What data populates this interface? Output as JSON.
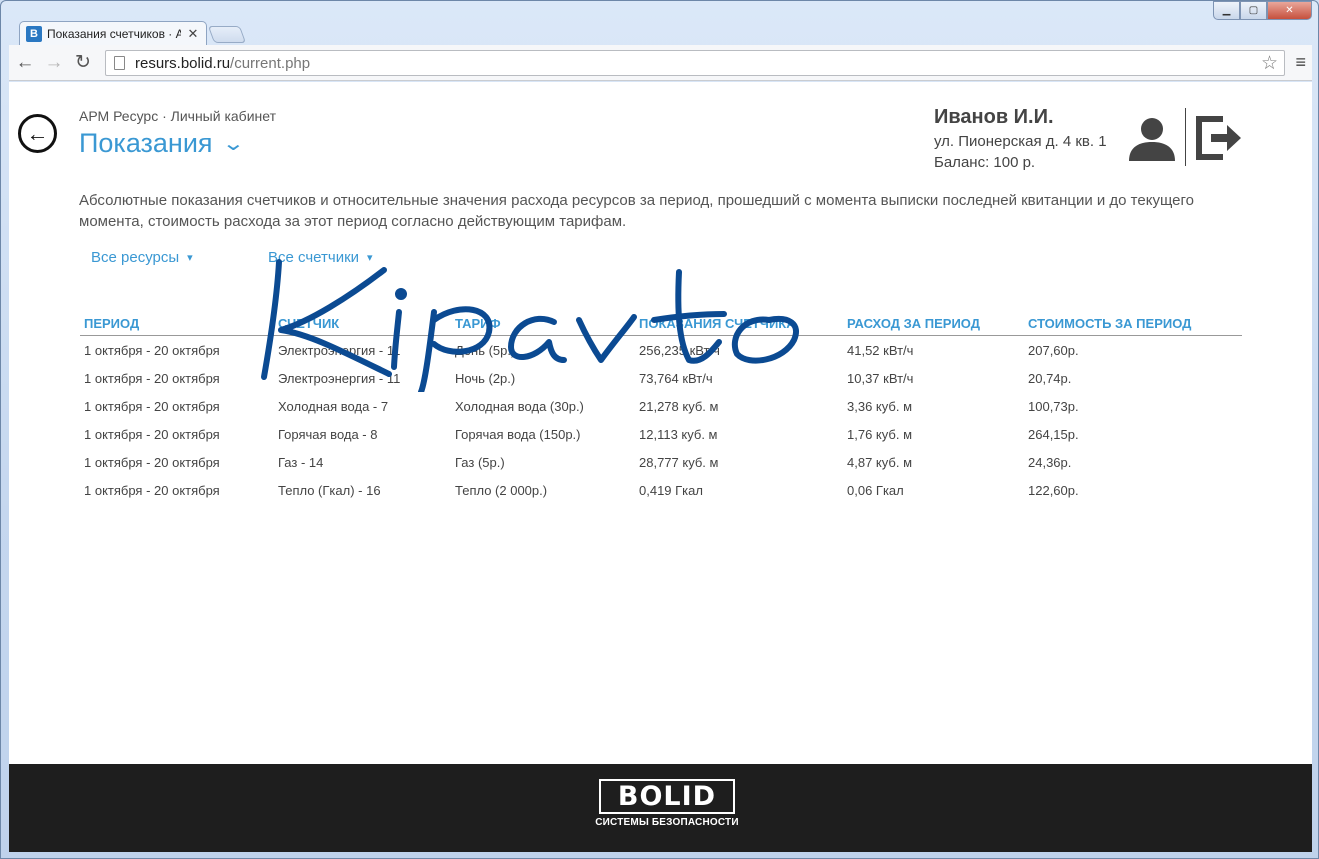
{
  "browser": {
    "tab_title": "Показания счетчиков · А",
    "favicon_letter": "B",
    "url_host": "resurs.bolid.ru",
    "url_path": "/current.php"
  },
  "header": {
    "breadcrumb": "АРМ Ресурс · Личный кабинет",
    "title": "Показания",
    "user_name": "Иванов И.И.",
    "user_address": "ул. Пионерская д. 4 кв. 1",
    "user_balance": "Баланс: 100 р."
  },
  "description": "Абсолютные показания счетчиков и относительные значения расхода ресурсов за период, прошедший с момента выписки последней квитанции и до текущего момента, стоимость расхода за этот период согласно действующим тарифам.",
  "filters": {
    "resources": "Все ресурсы",
    "meters": "Все счетчики"
  },
  "table": {
    "headers": [
      "ПЕРИОД",
      "СЧЕТЧИК",
      "ТАРИФ",
      "ПОКАЗАНИЯ СЧЕТЧИКА",
      "РАСХОД ЗА ПЕРИОД",
      "СТОИМОСТЬ ЗА ПЕРИОД"
    ],
    "rows": [
      [
        "1 октября - 20 октября",
        "Электроэнергия - 11",
        "День (5р.)",
        "256,235 кВт/ч",
        "41,52 кВт/ч",
        "207,60р."
      ],
      [
        "1 октября - 20 октября",
        "Электроэнергия - 11",
        "Ночь (2р.)",
        "73,764 кВт/ч",
        "10,37 кВт/ч",
        "20,74р."
      ],
      [
        "1 октября - 20 октября",
        "Холодная вода - 7",
        "Холодная вода (30р.)",
        "21,278 куб. м",
        "3,36 куб. м",
        "100,73р."
      ],
      [
        "1 октября - 20 октября",
        "Горячая вода - 8",
        "Горячая вода (150р.)",
        "12,113 куб. м",
        "1,76 куб. м",
        "264,15р."
      ],
      [
        "1 октября - 20 октября",
        "Газ - 14",
        "Газ (5р.)",
        "28,777 куб. м",
        "4,87 куб. м",
        "24,36р."
      ],
      [
        "1 октября - 20 октября",
        "Тепло (Гкал) - 16",
        "Тепло (2 000р.)",
        "0,419 Гкал",
        "0,06 Гкал",
        "122,60р."
      ]
    ]
  },
  "footer": {
    "logo_text": "BOLID",
    "logo_subtitle": "СИСТЕМЫ БЕЗОПАСНОСТИ"
  },
  "colors": {
    "accent": "#3a98d3",
    "signature_ink": "#0b4a92",
    "footer_bg": "#1e1e1e"
  },
  "icons": {
    "back": "arrow-left-circle-icon",
    "user": "user-icon",
    "logout": "logout-icon"
  }
}
